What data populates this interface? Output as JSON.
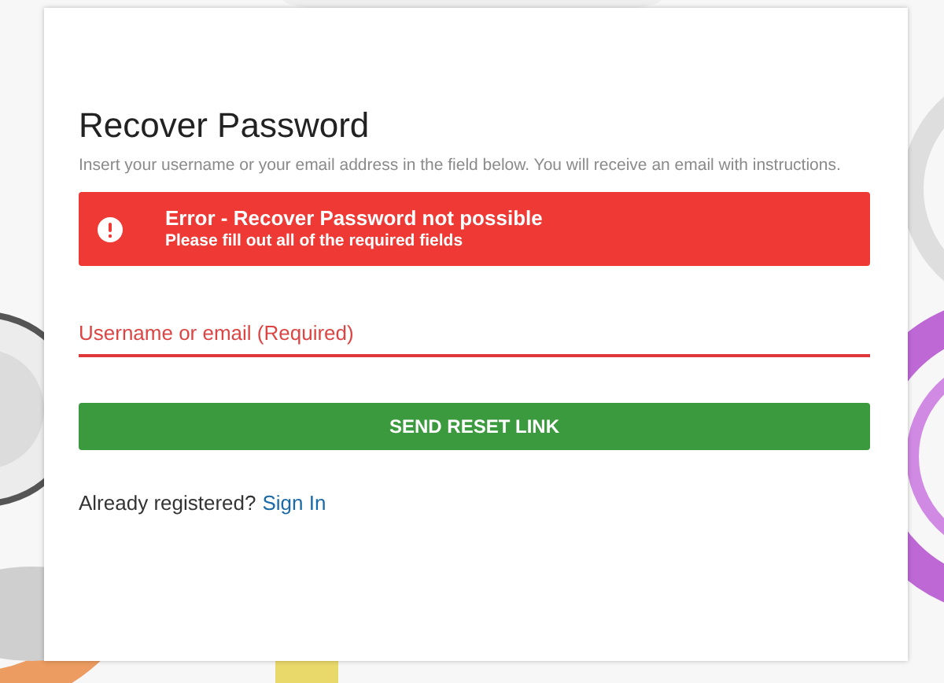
{
  "form": {
    "title": "Recover Password",
    "description": "Insert your username or your email address in the field below. You will receive an email with instructions.",
    "alert": {
      "kind": "error",
      "title": "Error - Recover Password not possible",
      "message": "Please fill out all of the required fields"
    },
    "field": {
      "placeholder": "Username or email (Required)",
      "error": true
    },
    "submit": "SEND RESET LINK",
    "footer": {
      "text": "Already registered?",
      "link": "Sign In"
    }
  }
}
